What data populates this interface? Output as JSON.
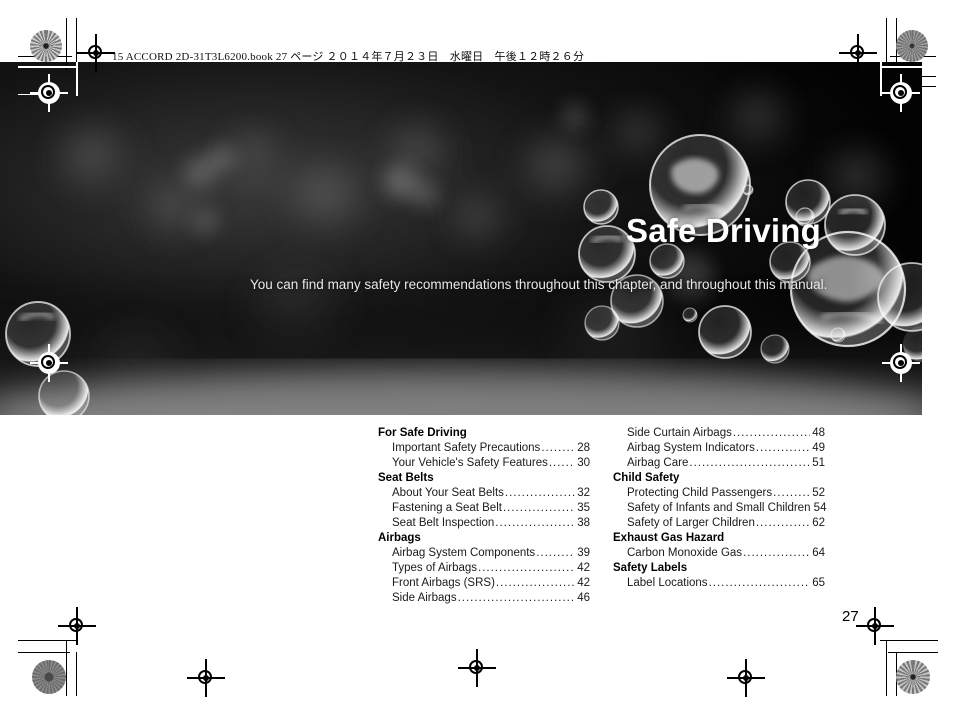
{
  "print_header": "15 ACCORD 2D-31T3L6200.book  27 ページ  ２０１４年７月２３日　水曜日　午後１２時２６分",
  "hero": {
    "title": "Safe Driving",
    "subtitle": "You can find many safety recommendations throughout this chapter, and throughout this manual.",
    "image_description": "soap-bubbles-bokeh-photo",
    "background_color": "#050505",
    "title_color": "#ffffff"
  },
  "page_number": "27",
  "toc": {
    "left_column": [
      {
        "type": "group",
        "label": "For Safe Driving"
      },
      {
        "type": "entry",
        "label": "Important Safety Precautions",
        "page": "28"
      },
      {
        "type": "entry",
        "label": "Your Vehicle's Safety Features",
        "page": "30"
      },
      {
        "type": "group",
        "label": "Seat Belts"
      },
      {
        "type": "entry",
        "label": "About Your Seat Belts",
        "page": "32"
      },
      {
        "type": "entry",
        "label": "Fastening a Seat Belt",
        "page": "35"
      },
      {
        "type": "entry",
        "label": "Seat Belt Inspection",
        "page": "38"
      },
      {
        "type": "group",
        "label": "Airbags"
      },
      {
        "type": "entry",
        "label": "Airbag System Components",
        "page": "39"
      },
      {
        "type": "entry",
        "label": "Types of Airbags",
        "page": "42"
      },
      {
        "type": "entry",
        "label": "Front Airbags (SRS)",
        "page": "42"
      },
      {
        "type": "entry",
        "label": "Side Airbags",
        "page": "46"
      }
    ],
    "right_column": [
      {
        "type": "entry",
        "label": "Side Curtain Airbags",
        "page": "48"
      },
      {
        "type": "entry",
        "label": "Airbag System Indicators",
        "page": "49"
      },
      {
        "type": "entry",
        "label": "Airbag Care",
        "page": "51"
      },
      {
        "type": "group",
        "label": "Child Safety"
      },
      {
        "type": "entry",
        "label": "Protecting Child Passengers",
        "page": "52"
      },
      {
        "type": "entry",
        "label": "Safety of Infants and Small Children",
        "page": "54"
      },
      {
        "type": "entry",
        "label": "Safety of Larger Children",
        "page": "62"
      },
      {
        "type": "group",
        "label": "Exhaust Gas Hazard"
      },
      {
        "type": "entry",
        "label": "Carbon Monoxide Gas",
        "page": "64"
      },
      {
        "type": "group",
        "label": "Safety Labels"
      },
      {
        "type": "entry",
        "label": "Label Locations",
        "page": "65"
      }
    ]
  },
  "printer_marks": {
    "registration_target": "registration-target",
    "color_wheel": "color-calibration-wheel",
    "crop_line": "crop-mark-line"
  }
}
